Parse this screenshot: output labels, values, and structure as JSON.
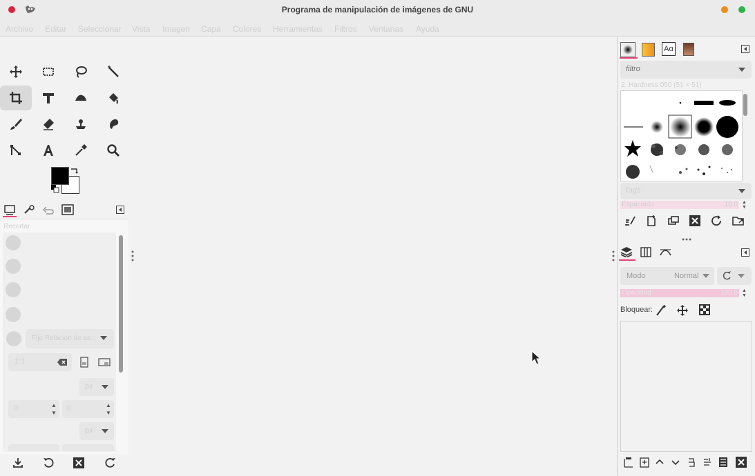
{
  "window": {
    "title": "Programa de manipulación de imágenes de GNU",
    "close_color": "#d7263d",
    "minimize_color": "#f08c1a",
    "maximize_color": "#2fb344"
  },
  "menu": [
    "Archivo",
    "Editar",
    "Seleccionar",
    "Vista",
    "Imagen",
    "Capa",
    "Colores",
    "Herramientas",
    "Filtros",
    "Ventanas",
    "Ayuda"
  ],
  "toolbox": {
    "tools": [
      "move",
      "rect-select",
      "free-select",
      "fuzzy-select",
      "crop",
      "unified-transform",
      "warp-transform",
      "bucket-fill",
      "paintbrush",
      "eraser",
      "clone",
      "smudge",
      "paths",
      "text",
      "color-picker",
      "zoom"
    ],
    "selected_tool": "crop",
    "fg_color": "#000000",
    "bg_color": "#ffffff"
  },
  "tool_options": {
    "heading": "Recortar",
    "aspect_dropdown": "Fijo Relación de as...",
    "ratio_value": "1:1",
    "unit_1": "px",
    "unit_2": "px",
    "pos_x": "0",
    "pos_y": "0"
  },
  "brushes": {
    "filter_placeholder": "filtro",
    "brush_name": "2. Hardness 050 (51 × 51)",
    "tag_placeholder": "Tags",
    "spacing_label": "Espaciado",
    "spacing_value": "10.0"
  },
  "layers": {
    "mode_label": "Modo",
    "mode_value": "Normal",
    "opacity_label": "Opacidad",
    "opacity_value": "100.0",
    "lock_label": "Bloquear:"
  }
}
